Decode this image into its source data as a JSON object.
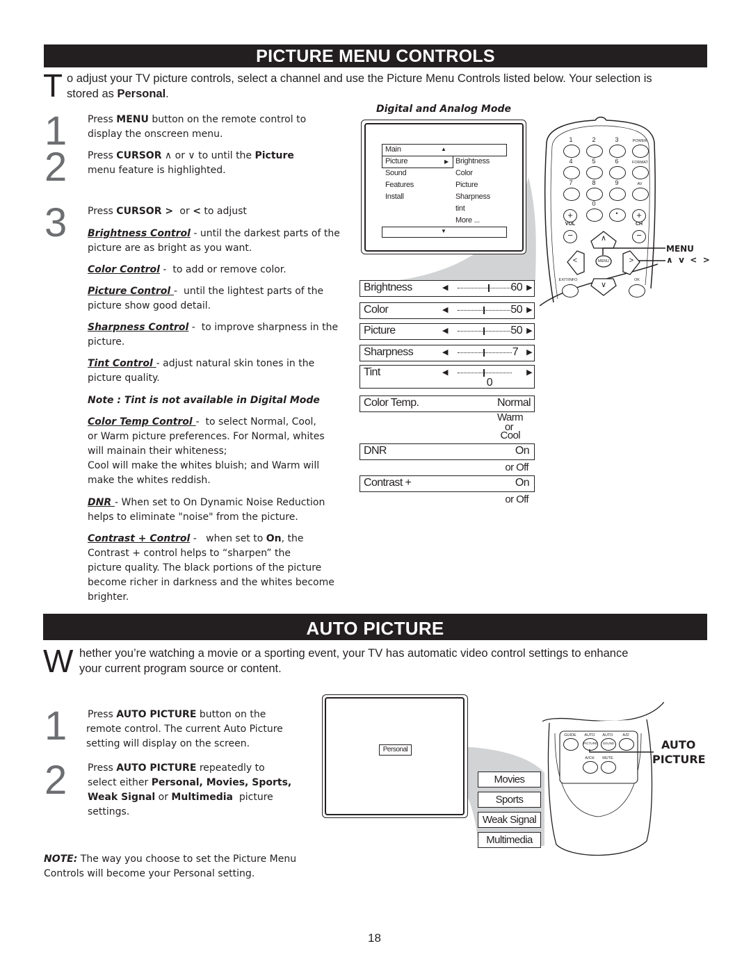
{
  "page_number": "18",
  "section1": {
    "title": "PICTURE MENU CONTROLS",
    "intro_dropcap": "T",
    "intro_text": "o adjust your TV picture controls, select a channel and use the Picture Menu Controls listed below. Your selection is",
    "intro_line2_pre": "stored as ",
    "intro_line2_bold": "Personal",
    "intro_line2_post": ".",
    "steps": [
      {
        "num": "1",
        "pre": "Press ",
        "bold": "MENU",
        "post": " button on the remote control to",
        "line2": "display the onscreen menu."
      },
      {
        "num": "2",
        "pre": "Press ",
        "bold": "CURSOR",
        "mid": "  ∧  or ∨ to until the ",
        "bold2": "Picture",
        "line2": "menu feature is highlighted."
      },
      {
        "num": "3",
        "pre": "Press ",
        "bold": "CURSOR",
        "mid_bold1": " > ",
        "mid": " or ",
        "mid_bold2": "<",
        "post": " to adjust"
      }
    ],
    "controls": [
      {
        "name": "Brightness Control",
        "desc": " - until the darkest parts of the",
        "line2": "picture are as bright as you want."
      },
      {
        "name": "Color Control",
        "desc": " -  to add or remove color."
      },
      {
        "name": "Picture Control ",
        "desc": "-  until the lightest parts of the",
        "line2": "picture show good detail."
      },
      {
        "name": "Sharpness Control",
        "desc": " -  to improve sharpness in the",
        "line2": "picture."
      },
      {
        "name": "Tint Control ",
        "desc": "- adjust natural skin tones in the",
        "line2": "picture quality."
      },
      {
        "name": "Color Temp Control ",
        "desc": "-  to select Normal, Cool,",
        "lines": [
          "or Warm picture preferences.  For Normal, whites",
          "will mainain their whiteness;",
          "Cool will make the whites bluish; and Warm will",
          "make the whites reddish."
        ]
      },
      {
        "name": "DNR ",
        "desc": "- When set to On Dynamic Noise Reduction",
        "line2": "helps to eliminate \"noise\" from the picture."
      },
      {
        "name": "Contrast + Control",
        "desc_pre": " -   when set to ",
        "desc_bold": "On",
        "desc_post": ", the",
        "lines": [
          "Contrast + control helps to “sharpen” the",
          "picture quality. The black portions of the picture",
          "become richer in darkness and the whites become",
          "brighter."
        ]
      }
    ],
    "tint_note": "Note : Tint is not available in Digital Mode",
    "diagram": {
      "mode_title": "Digital and Analog Mode",
      "menu": {
        "header": "Main",
        "left_items": [
          "Picture",
          "Sound",
          "Features",
          "Install"
        ],
        "right_items": [
          "Brightness",
          "Color",
          "Picture",
          "Sharpness",
          "tint",
          "More ..."
        ],
        "selected": "Picture"
      },
      "settings": [
        {
          "label": "Brightness",
          "value": "60",
          "level": 60
        },
        {
          "label": "Color",
          "value": "50",
          "level": 50
        },
        {
          "label": "Picture",
          "value": "50",
          "level": 50
        },
        {
          "label": "Sharpness",
          "value": "7",
          "level": 50
        },
        {
          "label": "Tint",
          "value": "0",
          "level": 50
        }
      ],
      "options": [
        {
          "label": "Color Temp.",
          "value": "Normal",
          "alternates": [
            "Warm",
            "or",
            "Cool"
          ]
        },
        {
          "label": "DNR",
          "value": "On",
          "alternates": [
            "or Off"
          ]
        },
        {
          "label": "Contrast +",
          "value": "On",
          "alternates": [
            "or Off"
          ]
        }
      ],
      "remote": {
        "number_keys": [
          "1",
          "2",
          "3",
          "4",
          "5",
          "6",
          "7",
          "8",
          "9",
          "0"
        ],
        "side_keys": [
          "POWER",
          "FORMAT",
          "AV"
        ],
        "dot_key": "•",
        "vol_label": "VOL",
        "ch_label": "CH",
        "plus": "+",
        "minus": "−",
        "menu_key": "MENU",
        "exit_key": "EXIT/INFO",
        "ok_key": "OK",
        "nav_up": "∧",
        "nav_down": "∨",
        "nav_left": "<",
        "nav_right": ">",
        "callout_menu": "MENU",
        "callout_cursor": "∧  v  <  >"
      }
    }
  },
  "section2": {
    "title": "AUTO PICTURE",
    "intro_dropcap": "W",
    "intro_text": "hether you’re watching a movie or a sporting event, your TV has automatic video control settings to enhance",
    "intro_line2": "your current program source or content.",
    "steps": [
      {
        "num": "1",
        "pre": "Press ",
        "bold": "AUTO PICTURE",
        "post": " button on the",
        "lines": [
          "remote control. The current Auto Picture",
          "setting will display on the screen."
        ]
      },
      {
        "num": "2",
        "pre": "Press ",
        "bold": "AUTO PICTURE",
        "post": " repeatedly to",
        "line2_pre": "select either ",
        "line2_bold": "Personal, Movies, Sports,",
        "line3_bold1": "Weak Signal",
        "line3_mid": " or ",
        "line3_bold2": "Multimedia",
        "line3_post": "  picture",
        "line4": "settings."
      }
    ],
    "note_label": "NOTE:",
    "note_text": " The way you choose to set the Picture Menu",
    "note_line2": "Controls will become your Personal setting.",
    "diagram": {
      "current_setting": "Personal",
      "options": [
        "Movies",
        "Sports",
        "Weak Signal",
        "Multimedia"
      ],
      "remote_keys": [
        "GUIDE",
        "AUTO",
        "AUTO",
        "A/D",
        "A/CH",
        "MUTE"
      ],
      "remote_key_inner": [
        "PICTURE",
        "SOUND"
      ],
      "callout_line1": "AUTO",
      "callout_line2": "PICTURE"
    }
  }
}
